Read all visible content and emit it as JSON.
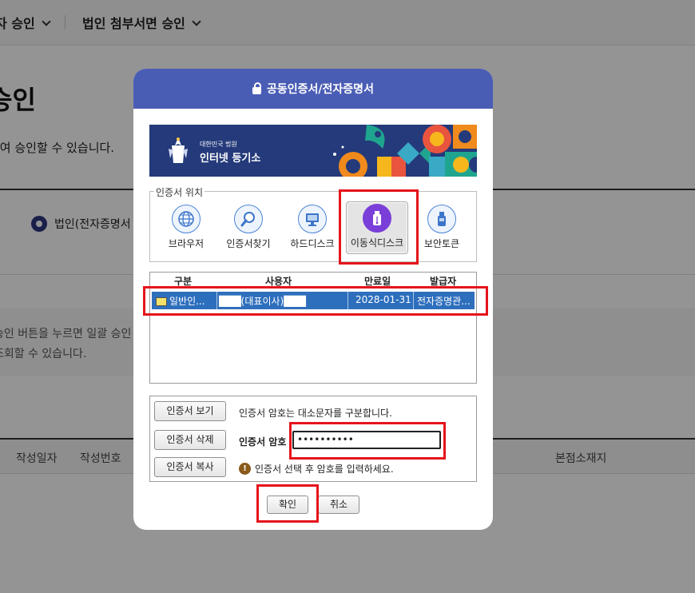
{
  "background": {
    "nav_item_1": "자 승인",
    "nav_item_2": "법인 첨부서면 승인",
    "title": "승인",
    "description": "하여 승인할 수 있습니다.",
    "radio_label": "법인(전자증명서",
    "notice_line_1": "승인 버튼을 누르면 일괄 승인",
    "notice_line_2": "조회할 수 있습니다.",
    "table_headers": [
      "작성일자",
      "작성번호",
      "본점소재지"
    ]
  },
  "modal": {
    "title": "공동인증서/전자증명서",
    "banner": {
      "subtitle": "대한민국 법원",
      "title": "인터넷 등기소"
    },
    "location": {
      "legend": "인증서 위치",
      "options": [
        {
          "label": "브라우저",
          "icon": "globe-icon"
        },
        {
          "label": "인증서찾기",
          "icon": "magnifier-icon"
        },
        {
          "label": "하드디스크",
          "icon": "monitor-icon"
        },
        {
          "label": "이동식디스크",
          "icon": "usb-icon",
          "selected": true
        },
        {
          "label": "보안토큰",
          "icon": "token-icon"
        }
      ]
    },
    "cert_list": {
      "headers": [
        "구분",
        "사용자",
        "만료일",
        "발급자"
      ],
      "rows": [
        {
          "type": "일반인...",
          "user": "███(대표이사)███",
          "expiry": "2028-01-31",
          "issuer": "전자증명관..."
        }
      ]
    },
    "buttons": {
      "view": "인증서 보기",
      "delete": "인증서 삭제",
      "copy": "인증서 복사",
      "ok": "확인",
      "cancel": "취소"
    },
    "password": {
      "note": "인증서 암호는 대소문자를 구분합니다.",
      "label": "인증서 암호",
      "value": "••••••••••",
      "warning": "인증서 선택 후 암호를 입력하세요."
    }
  },
  "colors": {
    "header_blue": "#4a5db5",
    "selection_blue": "#2e6fbd",
    "annotation_red": "#e5141b",
    "usb_purple": "#7a3fd8"
  }
}
